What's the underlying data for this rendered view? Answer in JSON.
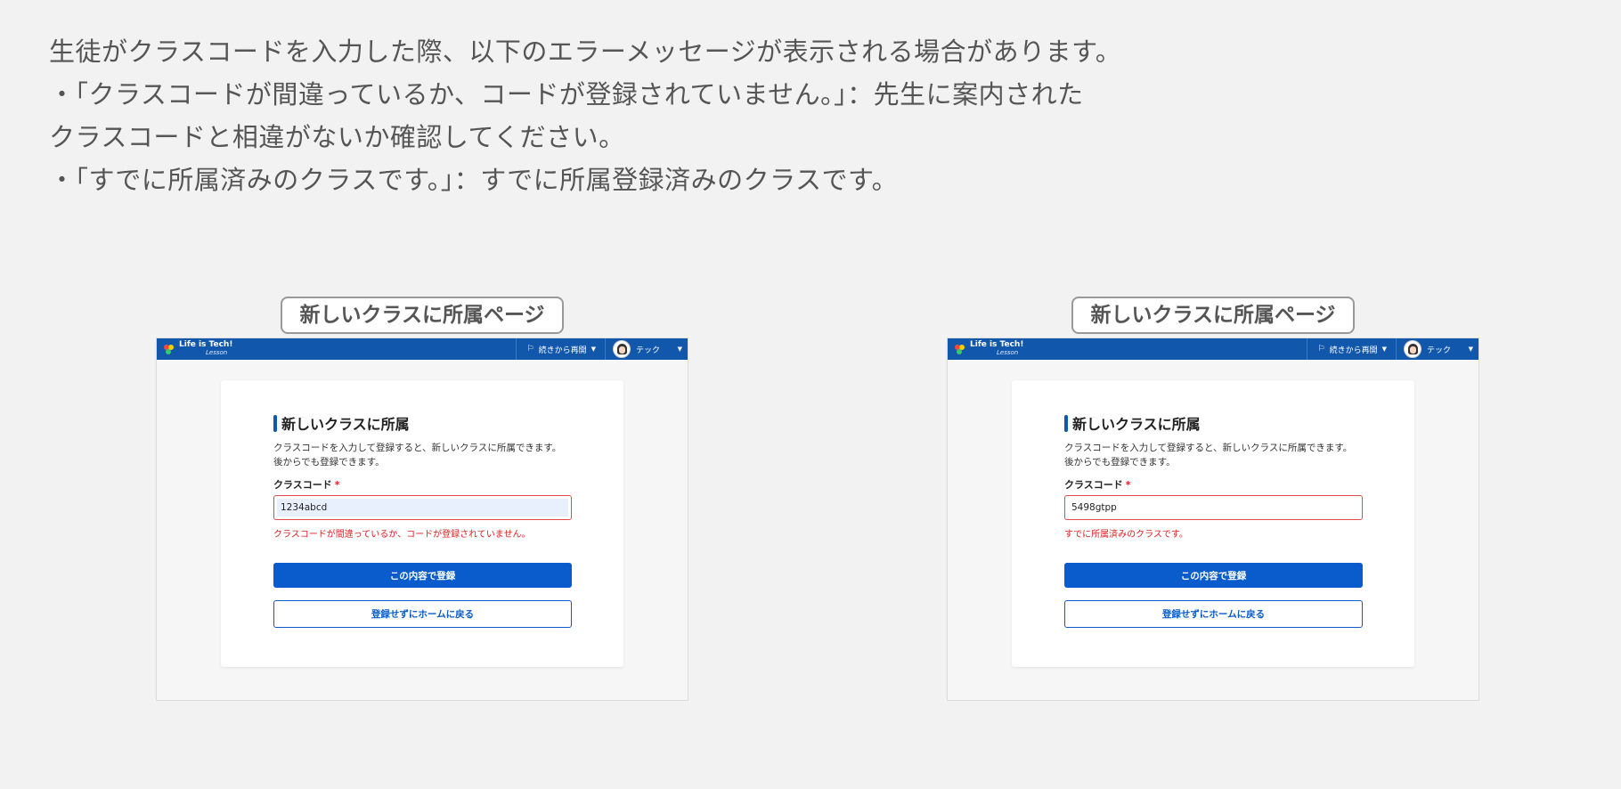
{
  "intro": {
    "lines": [
      "生徒がクラスコードを入力した際、以下のエラーメッセージが表示される場合があります。",
      "・「クラスコードが間違っているか、コードが登録されていません。」：先生に案内された",
      "クラスコードと相違がないか確認してください。",
      "・「すでに所属済みのクラスです。」：すでに所属登録済みのクラスです。"
    ]
  },
  "panels": [
    {
      "label": "新しいクラスに所属ページ",
      "header": {
        "logo_main": "Life is Tech!",
        "logo_sub": "Lesson",
        "resume_label": "続きから再開",
        "user_name": "テック"
      },
      "card": {
        "title": "新しいクラスに所属",
        "description": "クラスコードを入力して登録すると、新しいクラスに所属できます。 後からでも登録できます。",
        "field_label": "クラスコード",
        "required_mark": "*",
        "input_value": "1234abcd",
        "error": "クラスコードが間違っているか、コードが登録されていません。",
        "submit_label": "この内容で登録",
        "back_label": "登録せずにホームに戻る"
      }
    },
    {
      "label": "新しいクラスに所属ページ",
      "header": {
        "logo_main": "Life is Tech!",
        "logo_sub": "Lesson",
        "resume_label": "続きから再開",
        "user_name": "テック"
      },
      "card": {
        "title": "新しいクラスに所属",
        "description": "クラスコードを入力して登録すると、新しいクラスに所属できます。 後からでも登録できます。",
        "field_label": "クラスコード",
        "required_mark": "*",
        "input_value": "5498gtpp",
        "error": "すでに所属済みのクラスです。",
        "submit_label": "この内容で登録",
        "back_label": "登録せずにホームに戻る"
      }
    }
  ],
  "colors": {
    "header_blue": "#1158ad",
    "button_blue": "#0a5ccc",
    "error_red": "#d22222"
  }
}
